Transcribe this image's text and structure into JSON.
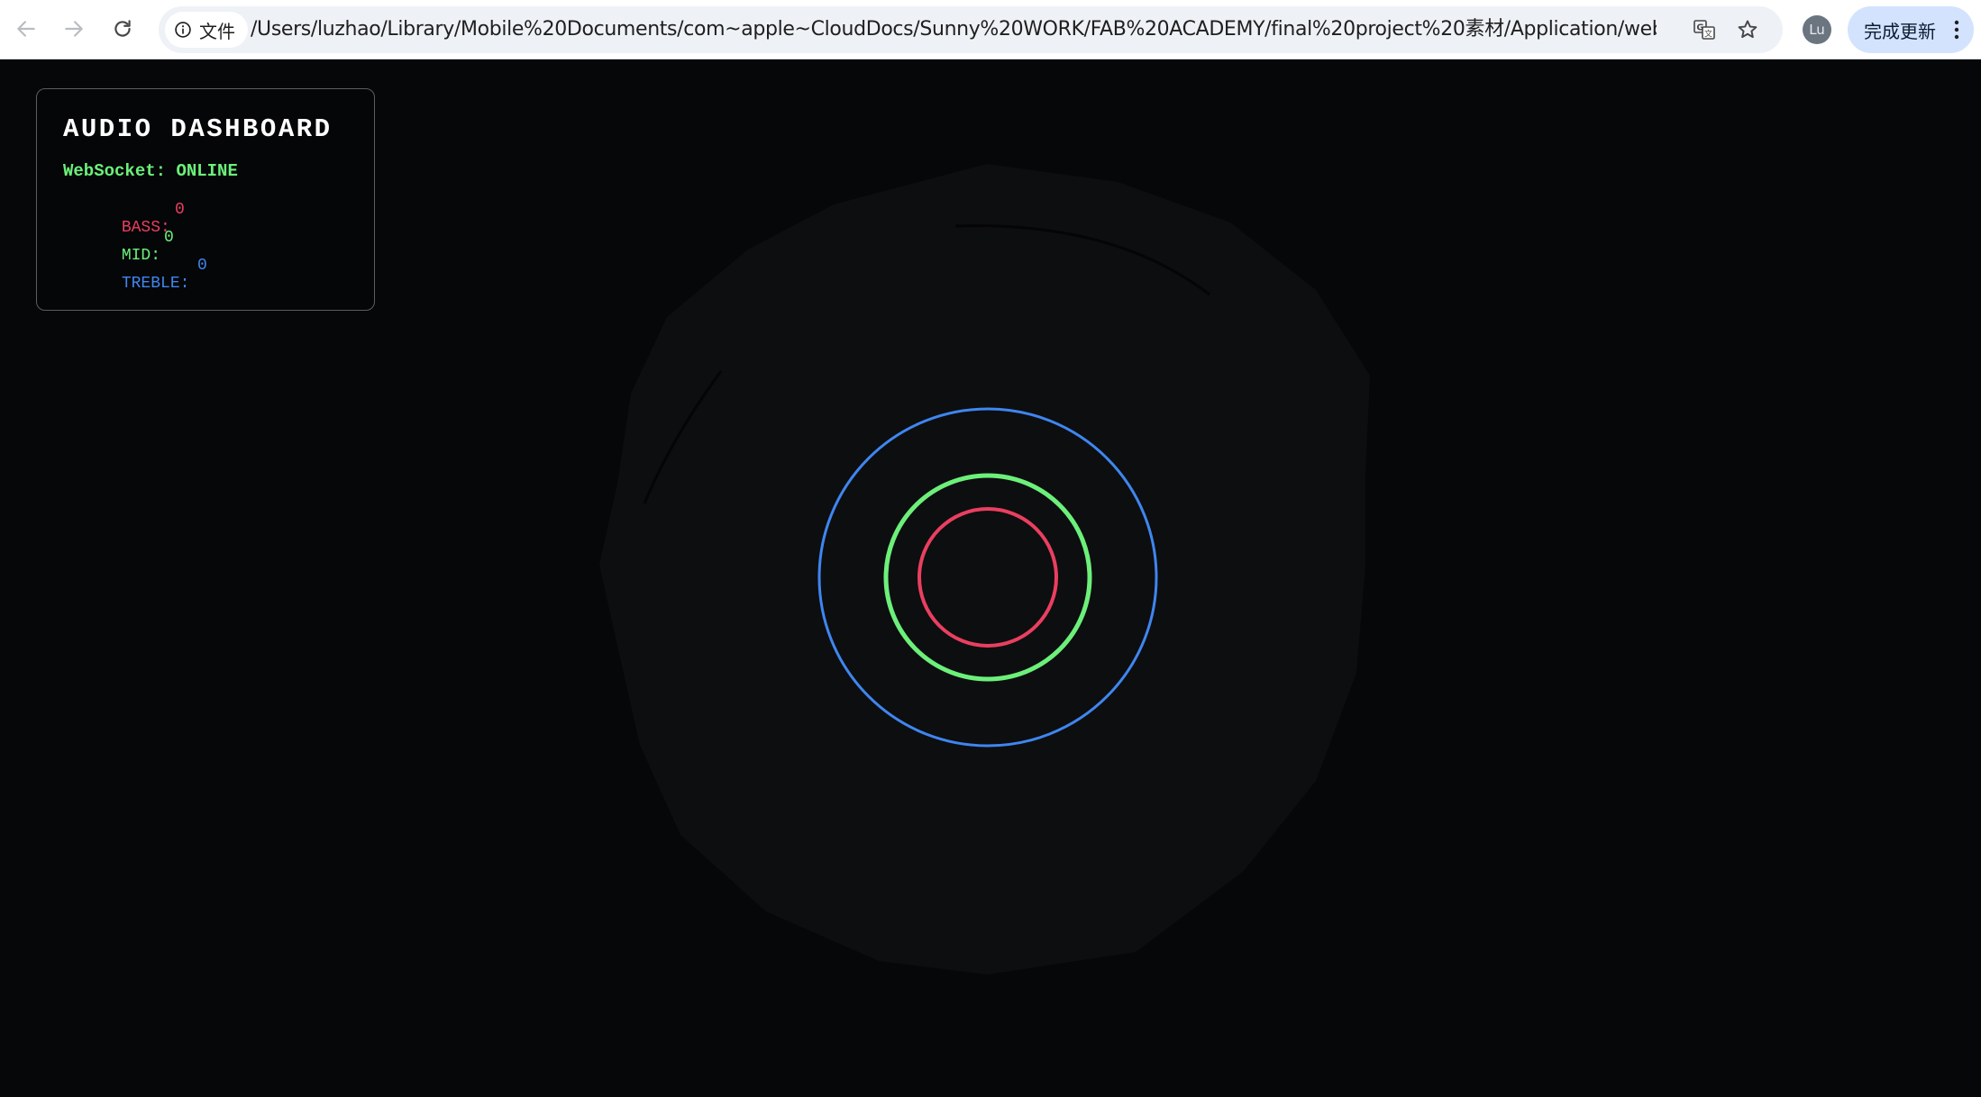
{
  "browser": {
    "site_chip_label": "文件",
    "url": "/Users/luzhao/Library/Mobile%20Documents/com~apple~CloudDocs/Sunny%20WORK/FAB%20ACADEMY/final%20project%20素材/Application/web%20sock...",
    "profile_initials": "Lu",
    "update_button_label": "完成更新",
    "icons": [
      "back-icon",
      "forward-icon",
      "reload-icon",
      "info-icon",
      "translate-icon",
      "star-icon",
      "more-vert-icon"
    ]
  },
  "dashboard": {
    "title": "AUDIO DASHBOARD",
    "websocket_label": "WebSocket:",
    "websocket_status": "ONLINE",
    "bands": [
      {
        "label": "BASS:",
        "value": "0",
        "color": "#ea3f60"
      },
      {
        "label": "MID:",
        "value": "0",
        "color": "#6cf07a"
      },
      {
        "label": "TREBLE:",
        "value": "0",
        "color": "#3f86f0"
      }
    ]
  },
  "visualizer": {
    "rings": [
      {
        "band": "treble",
        "color": "#3f86f0"
      },
      {
        "band": "mid",
        "color": "#6cf07a"
      },
      {
        "band": "bass",
        "color": "#ea3f60"
      }
    ],
    "blob_color": "#0d0e10"
  }
}
